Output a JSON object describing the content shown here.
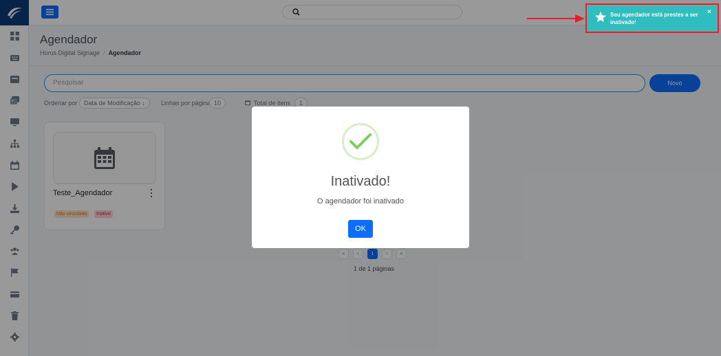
{
  "app": {
    "page_title": "Agendador",
    "breadcrumb": [
      "Horus Digital Signage",
      "Agendador"
    ]
  },
  "sidebar": {
    "items": [
      {
        "icon": "dashboard-icon"
      },
      {
        "icon": "keyboard-icon"
      },
      {
        "icon": "archive-icon"
      },
      {
        "icon": "images-icon"
      },
      {
        "icon": "monitor-icon"
      },
      {
        "icon": "sitemap-icon"
      },
      {
        "icon": "calendar-icon"
      },
      {
        "icon": "play-icon"
      },
      {
        "icon": "download-icon"
      },
      {
        "icon": "key-icon"
      },
      {
        "icon": "users-icon"
      },
      {
        "icon": "flag-icon"
      },
      {
        "icon": "card-icon"
      },
      {
        "icon": "trash-icon"
      },
      {
        "icon": "settings-icon"
      }
    ]
  },
  "search": {
    "placeholder": "Pesquisar",
    "new_label": "Novo"
  },
  "filters": {
    "order_label": "Ordenar por",
    "order_value": "Data de Modificação ↓",
    "rows_label": "Linhas por página",
    "rows_value": "10",
    "total_label": "Total de itens",
    "total_value": "1"
  },
  "card": {
    "name": "Teste_Agendador",
    "badge_link": "Não vinculado",
    "badge_status": "Inativo"
  },
  "pagination": {
    "first": "«",
    "prev": "‹",
    "current": "1",
    "next": "›",
    "last": "»",
    "summary": "1 de 1 páginas"
  },
  "modal": {
    "title": "Inativado!",
    "text": "O agendador foi inativado",
    "ok_label": "OK"
  },
  "toast": {
    "message": "Seu agendador está prestes a ser inativado!",
    "close": "×"
  },
  "colors": {
    "primary": "#0d6efd",
    "toast": "#2fbdc0",
    "highlight": "#e0202a",
    "success": "#7ccf5c"
  }
}
